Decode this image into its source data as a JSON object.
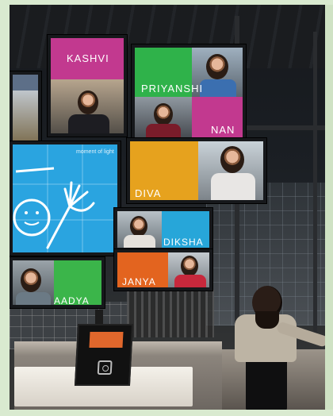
{
  "screens": {
    "kashvi": {
      "name": "KASHVI",
      "color": "#c2398f"
    },
    "priyanshi": {
      "name": "PRIYANSHI",
      "color": "#2fb24a"
    },
    "nan": {
      "name": "NAN",
      "color": "#c2398f"
    },
    "diva": {
      "name": "DIVA",
      "color": "#e6a21e"
    },
    "diksha": {
      "name": "DIKSHA",
      "color": "#27a6d9"
    },
    "janya": {
      "name": "JANYA",
      "color": "#e3641f"
    },
    "aadya": {
      "name": "AADYA",
      "color": "#3bb54a"
    },
    "moment": {
      "caption": "moment of light",
      "color": "#2aa4e0"
    }
  }
}
